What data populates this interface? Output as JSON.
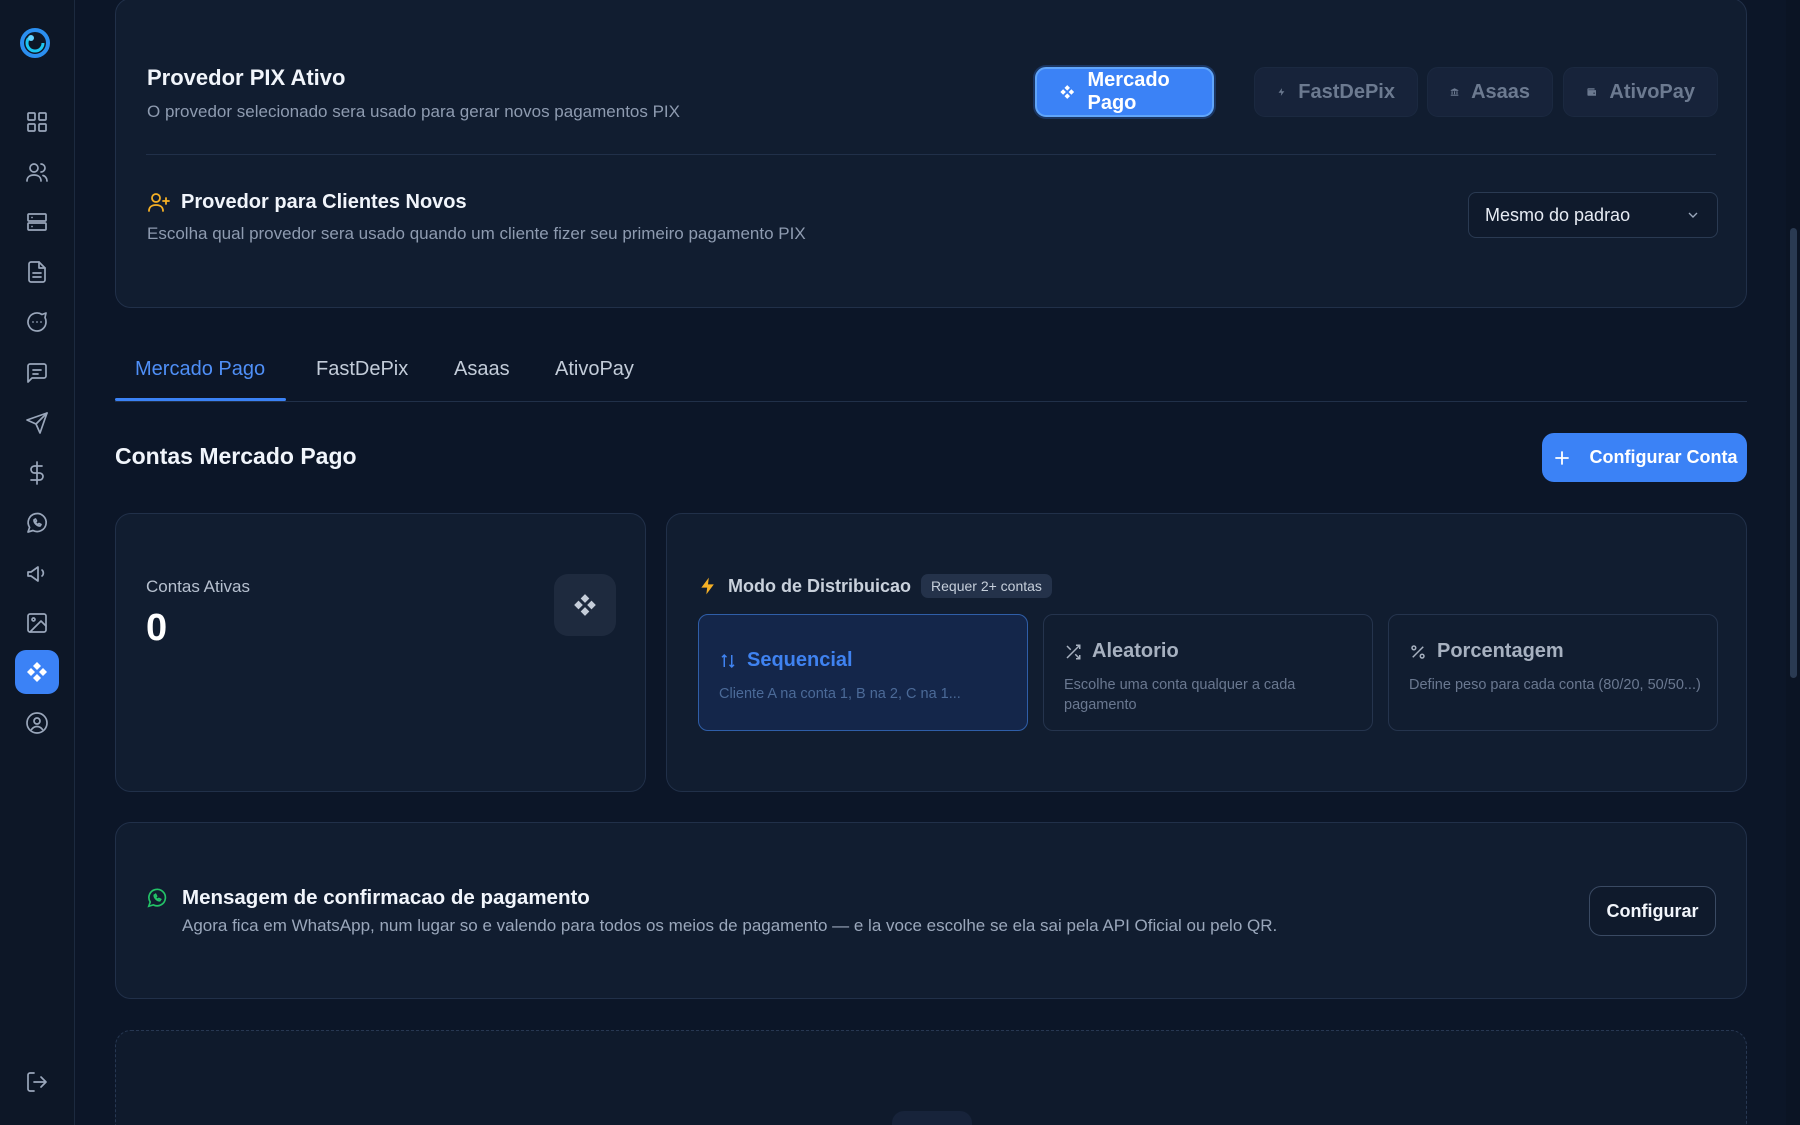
{
  "sidebar": {
    "logo": "app-logo",
    "items": [
      {
        "icon": "dashboard-grid-icon"
      },
      {
        "icon": "users-icon"
      },
      {
        "icon": "server-icon"
      },
      {
        "icon": "document-icon"
      },
      {
        "icon": "chat-bubble-icon"
      },
      {
        "icon": "message-square-icon"
      },
      {
        "icon": "send-icon"
      },
      {
        "icon": "dollar-icon"
      },
      {
        "icon": "whatsapp-icon"
      },
      {
        "icon": "megaphone-icon"
      },
      {
        "icon": "image-icon"
      },
      {
        "icon": "pix-icon",
        "active": true
      },
      {
        "icon": "user-circle-icon"
      }
    ],
    "logout_icon": "logout-icon"
  },
  "provider_card": {
    "title": "Provedor PIX Ativo",
    "subtitle": "O provedor selecionado sera usado para gerar novos pagamentos PIX",
    "providers": [
      {
        "label": "Mercado Pago",
        "icon": "pix-icon",
        "active": true
      },
      {
        "label": "FastDePix",
        "icon": "lightning-icon",
        "active": false
      },
      {
        "label": "Asaas",
        "icon": "bank-icon",
        "active": false
      },
      {
        "label": "AtivoPay",
        "icon": "wallet-icon",
        "active": false
      }
    ],
    "new_clients": {
      "title": "Provedor para Clientes Novos",
      "subtitle": "Escolha qual provedor sera usado quando um cliente fizer seu primeiro pagamento PIX",
      "select_value": "Mesmo do padrao"
    }
  },
  "tabs": [
    {
      "label": "Mercado Pago",
      "active": true
    },
    {
      "label": "FastDePix",
      "active": false
    },
    {
      "label": "Asaas",
      "active": false
    },
    {
      "label": "AtivoPay",
      "active": false
    }
  ],
  "accounts": {
    "title": "Contas Mercado Pago",
    "add_button": "Configurar Conta",
    "active_label": "Contas Ativas",
    "active_count": "0"
  },
  "distribution": {
    "title": "Modo de Distribuicao",
    "badge": "Requer 2+ contas",
    "modes": [
      {
        "title": "Sequencial",
        "desc": "Cliente A na conta 1, B na 2, C na 1...",
        "icon": "sort-arrows-icon",
        "active": true
      },
      {
        "title": "Aleatorio",
        "desc": "Escolhe uma conta qualquer a cada pagamento",
        "icon": "shuffle-icon",
        "active": false
      },
      {
        "title": "Porcentagem",
        "desc": "Define peso para cada conta (80/20, 50/50...)",
        "icon": "percent-icon",
        "active": false
      }
    ]
  },
  "message": {
    "title": "Mensagem de confirmacao de pagamento",
    "desc": "Agora fica em WhatsApp, num lugar so e valendo para todos os meios de pagamento — e la voce escolhe se ela sai pela API Oficial ou pelo QR.",
    "button": "Configurar"
  },
  "colors": {
    "accent": "#3b82f6",
    "background": "#0c1628",
    "card": "#111d30",
    "whatsapp": "#23c367",
    "warning": "#f5b025"
  }
}
